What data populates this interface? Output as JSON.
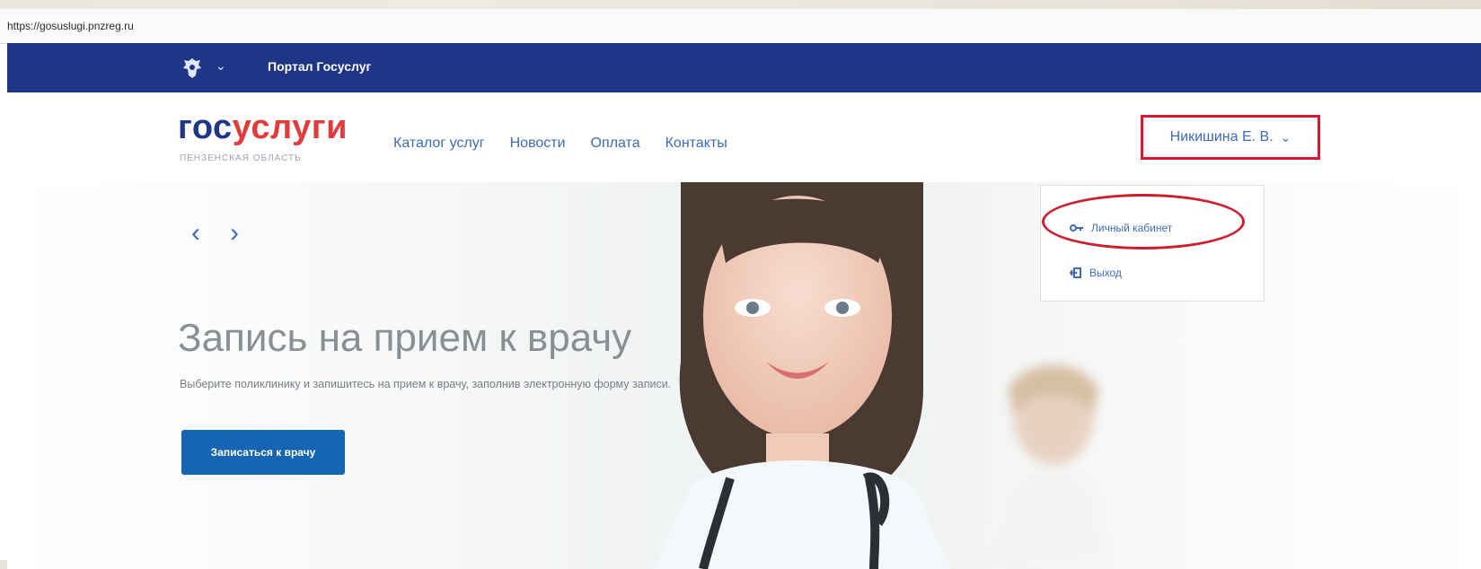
{
  "browser": {
    "url": "https://gosuslugi.pnzreg.ru"
  },
  "topbar": {
    "portal_title": "Портал Госуслуг"
  },
  "header": {
    "logo_part1": "гос",
    "logo_part2": "услуги",
    "logo_sub": "ПЕНЗЕНСКАЯ ОБЛАСТЬ",
    "nav": [
      "Каталог услуг",
      "Новости",
      "Оплата",
      "Контакты"
    ],
    "user_name": "Никишина Е. В."
  },
  "user_menu": {
    "cabinet_label": "Личный кабинет",
    "logout_label": "Выход"
  },
  "hero": {
    "prev": "‹",
    "next": "›",
    "title": "Запись на прием к врачу",
    "description": "Выберите поликлинику и запишитесь на прием к врачу, заполнив электронную форму записи.",
    "button_label": "Записаться к врачу"
  },
  "colors": {
    "topbar": "#1f3585",
    "logo_blue": "#1f3585",
    "logo_red": "#e23b3b",
    "link": "#3d6bb8",
    "button": "#1565b4",
    "highlight": "#e0142f"
  }
}
